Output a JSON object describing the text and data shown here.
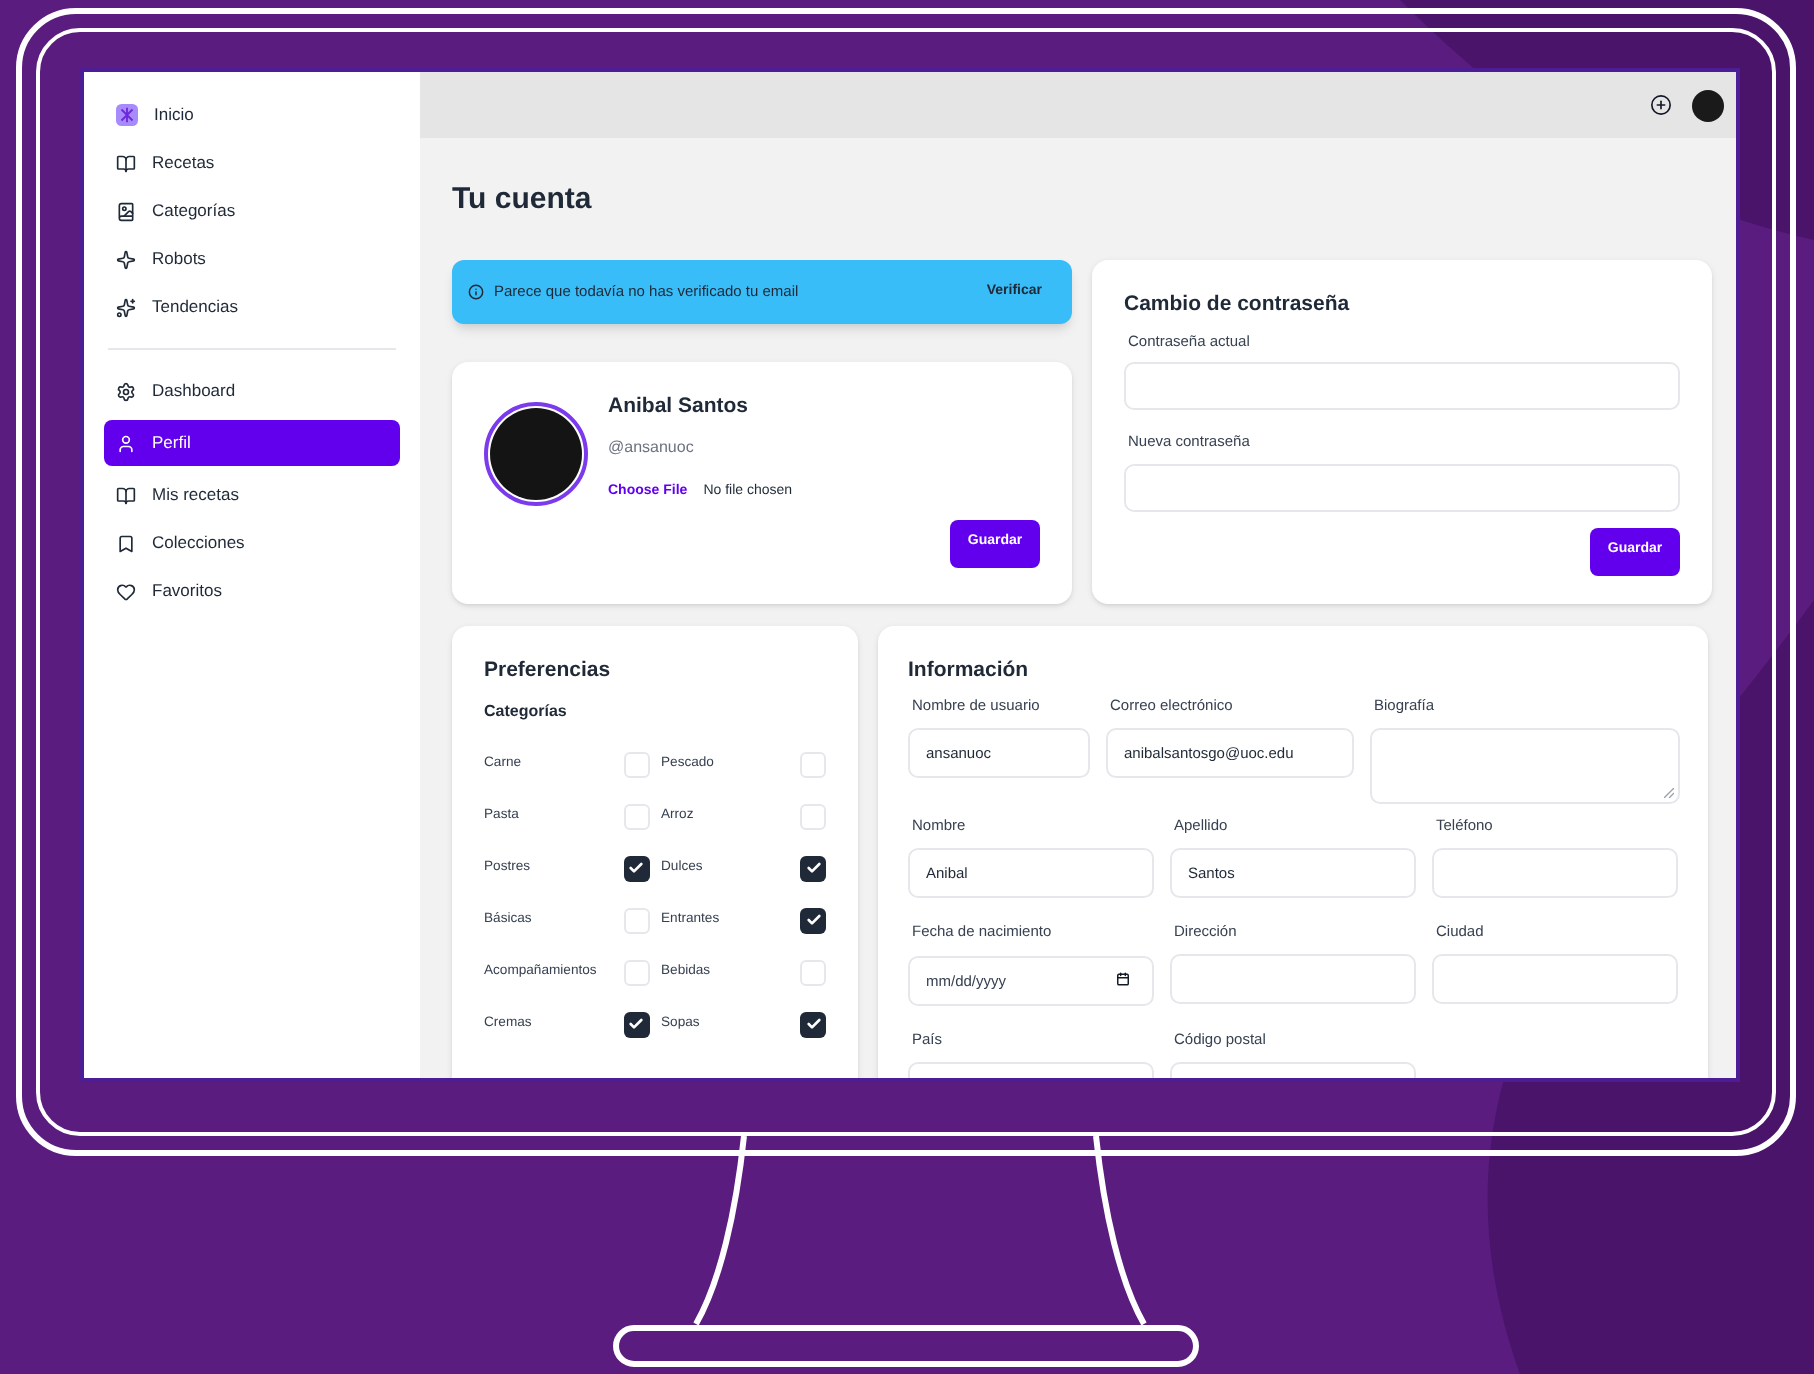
{
  "sidebar": {
    "groups": [
      [
        {
          "label": "Inicio",
          "selected": false
        },
        {
          "label": "Recetas",
          "selected": false
        },
        {
          "label": "Categorías",
          "selected": false
        },
        {
          "label": "Robots",
          "selected": false
        },
        {
          "label": "Tendencias",
          "selected": false
        }
      ],
      [
        {
          "label": "Dashboard",
          "selected": false
        },
        {
          "label": "Perfil",
          "selected": true
        },
        {
          "label": "Mis recetas",
          "selected": false
        },
        {
          "label": "Colecciones",
          "selected": false
        },
        {
          "label": "Favoritos",
          "selected": false
        }
      ]
    ]
  },
  "page_title": "Tu cuenta",
  "alert": {
    "message": "Parece que todavía no has verificado tu email",
    "action": "Verificar"
  },
  "profile": {
    "name": "Anibal Santos",
    "handle": "@ansanuoc",
    "file_button": "Choose File",
    "file_status": "No file chosen",
    "save": "Guardar"
  },
  "password": {
    "title": "Cambio de contraseña",
    "fields": [
      {
        "label": "Contraseña actual"
      },
      {
        "label": "Nueva contraseña"
      }
    ],
    "save": "Guardar"
  },
  "preferences": {
    "title": "Preferencias",
    "subtitle": "Categorías",
    "categories": [
      {
        "label": "Carne",
        "checked": false
      },
      {
        "label": "Pescado",
        "checked": false
      },
      {
        "label": "Pasta",
        "checked": false
      },
      {
        "label": "Arroz",
        "checked": false
      },
      {
        "label": "Postres",
        "checked": true
      },
      {
        "label": "Dulces",
        "checked": true
      },
      {
        "label": "Básicas",
        "checked": false
      },
      {
        "label": "Entrantes",
        "checked": true
      },
      {
        "label": "Acompañamientos",
        "checked": false
      },
      {
        "label": "Bebidas",
        "checked": false
      },
      {
        "label": "Cremas",
        "checked": true
      },
      {
        "label": "Sopas",
        "checked": true
      }
    ]
  },
  "information": {
    "title": "Información",
    "top_fields": [
      {
        "label": "Nombre de usuario",
        "value": "ansanuoc",
        "kind": "text"
      },
      {
        "label": "Correo electrónico",
        "value": "anibalsantosgo@uoc.edu",
        "kind": "text"
      },
      {
        "label": "Biografía",
        "kind": "textarea"
      }
    ],
    "fields": [
      {
        "label": "Nombre",
        "value": "Anibal",
        "kind": "text"
      },
      {
        "label": "Apellido",
        "value": "Santos",
        "kind": "text"
      },
      {
        "label": "Teléfono",
        "kind": "text"
      },
      {
        "label": "Fecha de nacimiento",
        "placeholder": "mm/dd/yyyy",
        "kind": "date"
      },
      {
        "label": "Dirección",
        "kind": "text"
      },
      {
        "label": "Ciudad",
        "kind": "text"
      },
      {
        "label": "País",
        "kind": "text"
      },
      {
        "label": "Código postal",
        "kind": "text"
      }
    ]
  }
}
